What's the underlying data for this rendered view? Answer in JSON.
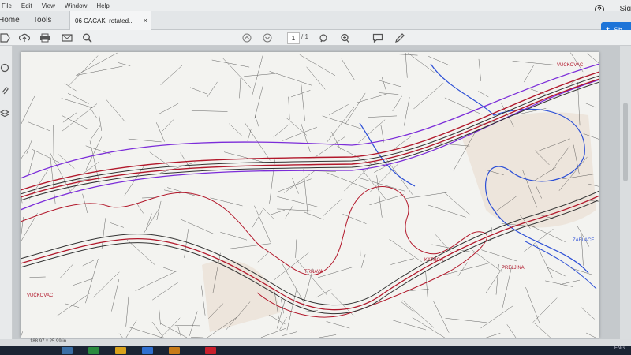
{
  "menu": {
    "items": [
      "File",
      "Edit",
      "View",
      "Window",
      "Help"
    ]
  },
  "header": {
    "signin_label": "Sig",
    "help_label": "?"
  },
  "tabs": {
    "home": "Home",
    "tools": "Tools",
    "document": "06 CACAK_rotated...",
    "close": "×"
  },
  "share": {
    "label": "Sh"
  },
  "toolbar": {
    "page_current": "1",
    "page_total": "/ 1"
  },
  "status": {
    "dimensions": "188.97 x 25.99 in"
  },
  "taskbar": {
    "language": "ENG"
  },
  "colors": {
    "road": "#b2182b",
    "corridor": "#7b2cd9",
    "river": "#2c4fd6",
    "parcels": "#333333",
    "accent": "#1d74d8"
  },
  "map_labels": [
    {
      "text": "VUČKOVAC"
    },
    {
      "text": "VUČKOVAC"
    },
    {
      "text": "TRNAVA"
    },
    {
      "text": "KATRGA"
    },
    {
      "text": "PRELJINA"
    },
    {
      "text": "ZABLAĆE"
    }
  ]
}
